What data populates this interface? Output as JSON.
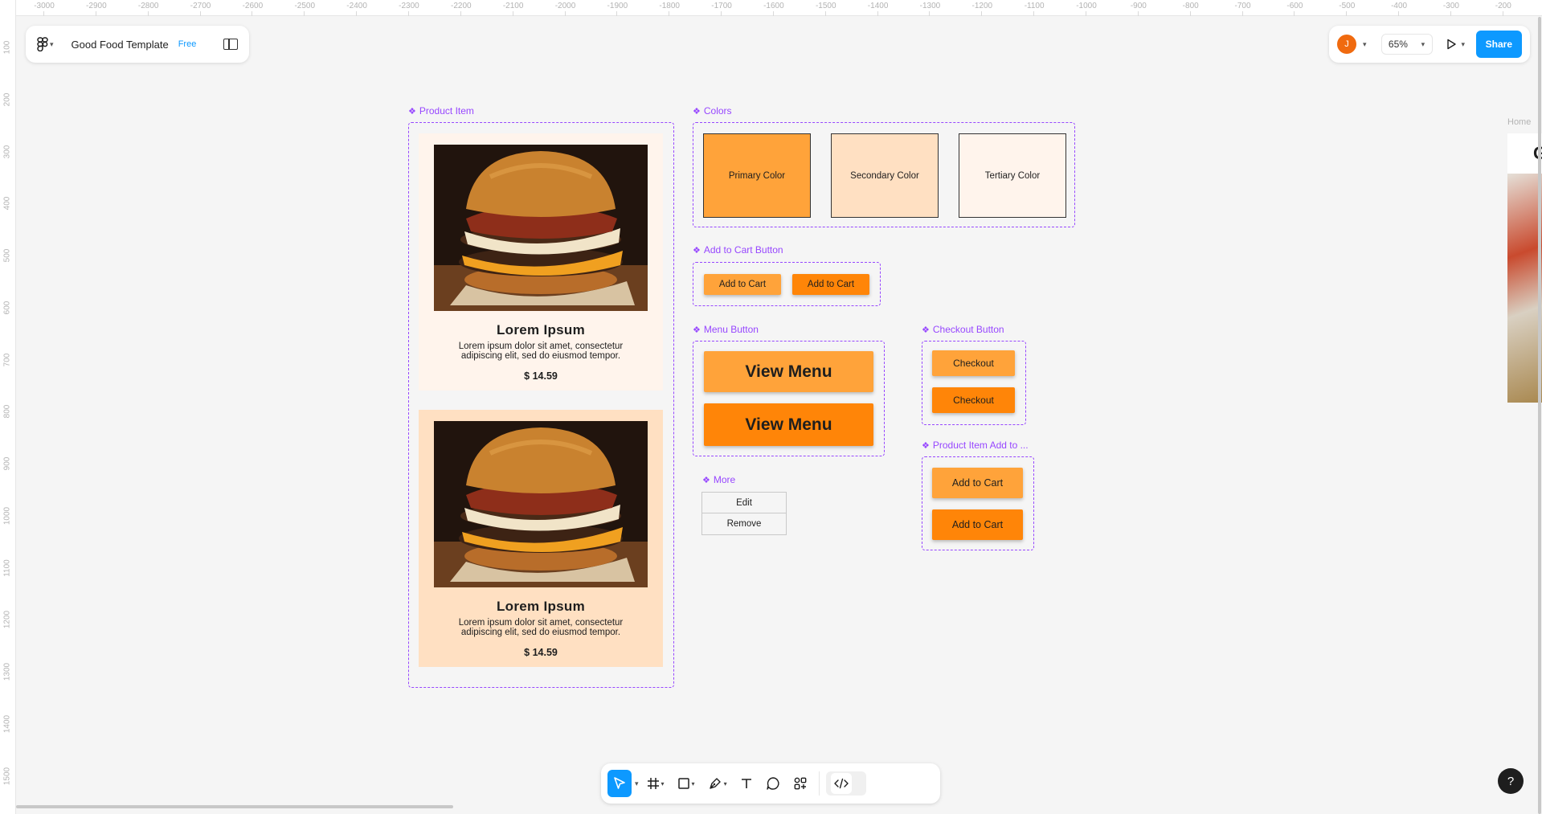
{
  "rulers": {
    "top": [
      "-3000",
      "-2900",
      "-2800",
      "-2700",
      "-2600",
      "-2500",
      "-2400",
      "-2300",
      "-2200",
      "-2100",
      "-2000",
      "-1900",
      "-1800",
      "-1700",
      "-1600",
      "-1500",
      "-1400",
      "-1300",
      "-1200",
      "-1100",
      "-1000",
      "-900",
      "-800",
      "-700",
      "-600",
      "-500",
      "-400",
      "-300",
      "-200"
    ],
    "left": [
      "100",
      "200",
      "300",
      "400",
      "500",
      "600",
      "700",
      "800",
      "900",
      "1000",
      "1100",
      "1200",
      "1300",
      "1400",
      "1500"
    ]
  },
  "file": {
    "name": "Good Food Template",
    "plan_badge": "Free"
  },
  "header_right": {
    "avatar_initial": "J",
    "zoom": "65%",
    "share_label": "Share"
  },
  "frames": {
    "product_item": "Product Item",
    "colors": "Colors",
    "add_to_cart": "Add to Cart Button",
    "menu_button": "Menu Button",
    "checkout": "Checkout Button",
    "more": "More",
    "product_add": "Product Item Add to ..."
  },
  "product_cards": [
    {
      "title": "Lorem Ipsum",
      "description": "Lorem ipsum dolor sit amet, consectetur adipiscing elit, sed do eiusmod tempor.",
      "price": "$ 14.59"
    },
    {
      "title": "Lorem Ipsum",
      "description": "Lorem ipsum dolor sit amet, consectetur adipiscing elit, sed do eiusmod tempor.",
      "price": "$ 14.59"
    }
  ],
  "colors": {
    "primary": {
      "label": "Primary Color",
      "hex": "#ffa33a"
    },
    "secondary": {
      "label": "Secondary Color",
      "hex": "#ffe0c2"
    },
    "tertiary": {
      "label": "Tertiary Color",
      "hex": "#fff4ec"
    }
  },
  "buttons": {
    "add_to_cart": [
      "Add to Cart",
      "Add to Cart"
    ],
    "view_menu": [
      "View Menu",
      "View Menu"
    ],
    "checkout": [
      "Checkout",
      "Checkout"
    ],
    "product_add": [
      "Add to Cart",
      "Add to Cart"
    ]
  },
  "more_menu": [
    "Edit",
    "Remove"
  ],
  "edge_frame": {
    "label": "Home",
    "letter": "G"
  },
  "toolbar": [
    "move-tool",
    "frame-tool",
    "shape-tool",
    "pen-tool",
    "text-tool",
    "comment-tool",
    "actions-tool",
    "dev-mode-toggle"
  ],
  "help_label": "?"
}
